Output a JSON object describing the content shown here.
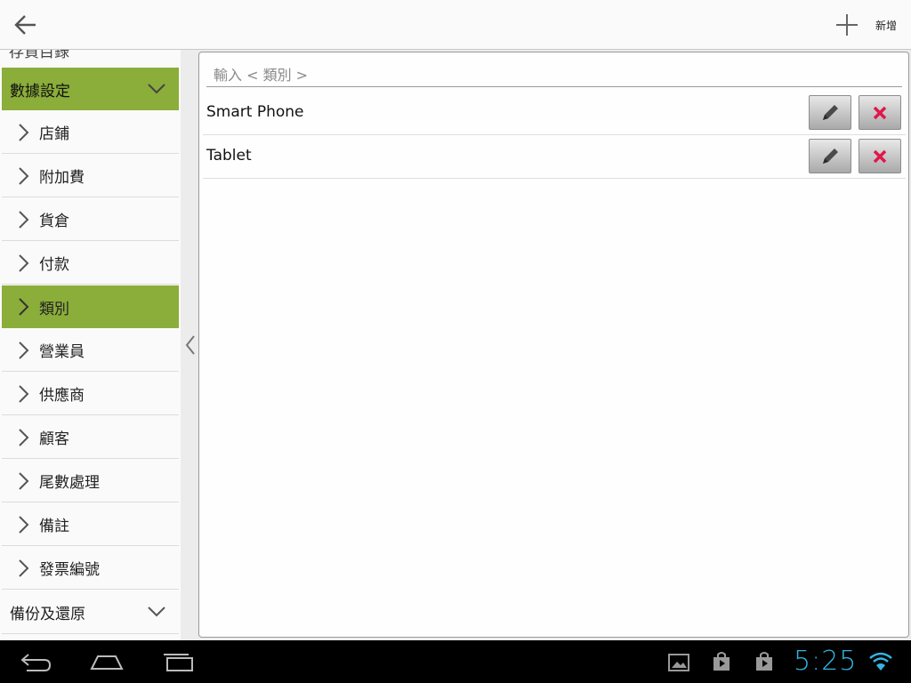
{
  "actionbar": {
    "add_label": "新增"
  },
  "sidebar": {
    "partial_top_label": "存貨目錄",
    "groups": [
      {
        "label": "數據設定",
        "expanded": true
      },
      {
        "label": "備份及還原",
        "expanded": false
      }
    ],
    "items": [
      {
        "label": "店鋪"
      },
      {
        "label": "附加費"
      },
      {
        "label": "貨倉"
      },
      {
        "label": "付款"
      },
      {
        "label": "類別",
        "selected": true
      },
      {
        "label": "營業員"
      },
      {
        "label": "供應商"
      },
      {
        "label": "顧客"
      },
      {
        "label": "尾數處理"
      },
      {
        "label": "備註"
      },
      {
        "label": "發票編號"
      }
    ]
  },
  "main": {
    "search": {
      "placeholder": "輸入 < 類別 >",
      "value": ""
    },
    "rows": [
      {
        "label": "Smart Phone"
      },
      {
        "label": "Tablet"
      }
    ]
  },
  "statusbar": {
    "time": "5:25"
  },
  "colors": {
    "accent": "#8bad3a",
    "clock": "#33b5e5",
    "delete": "#e0184a"
  }
}
